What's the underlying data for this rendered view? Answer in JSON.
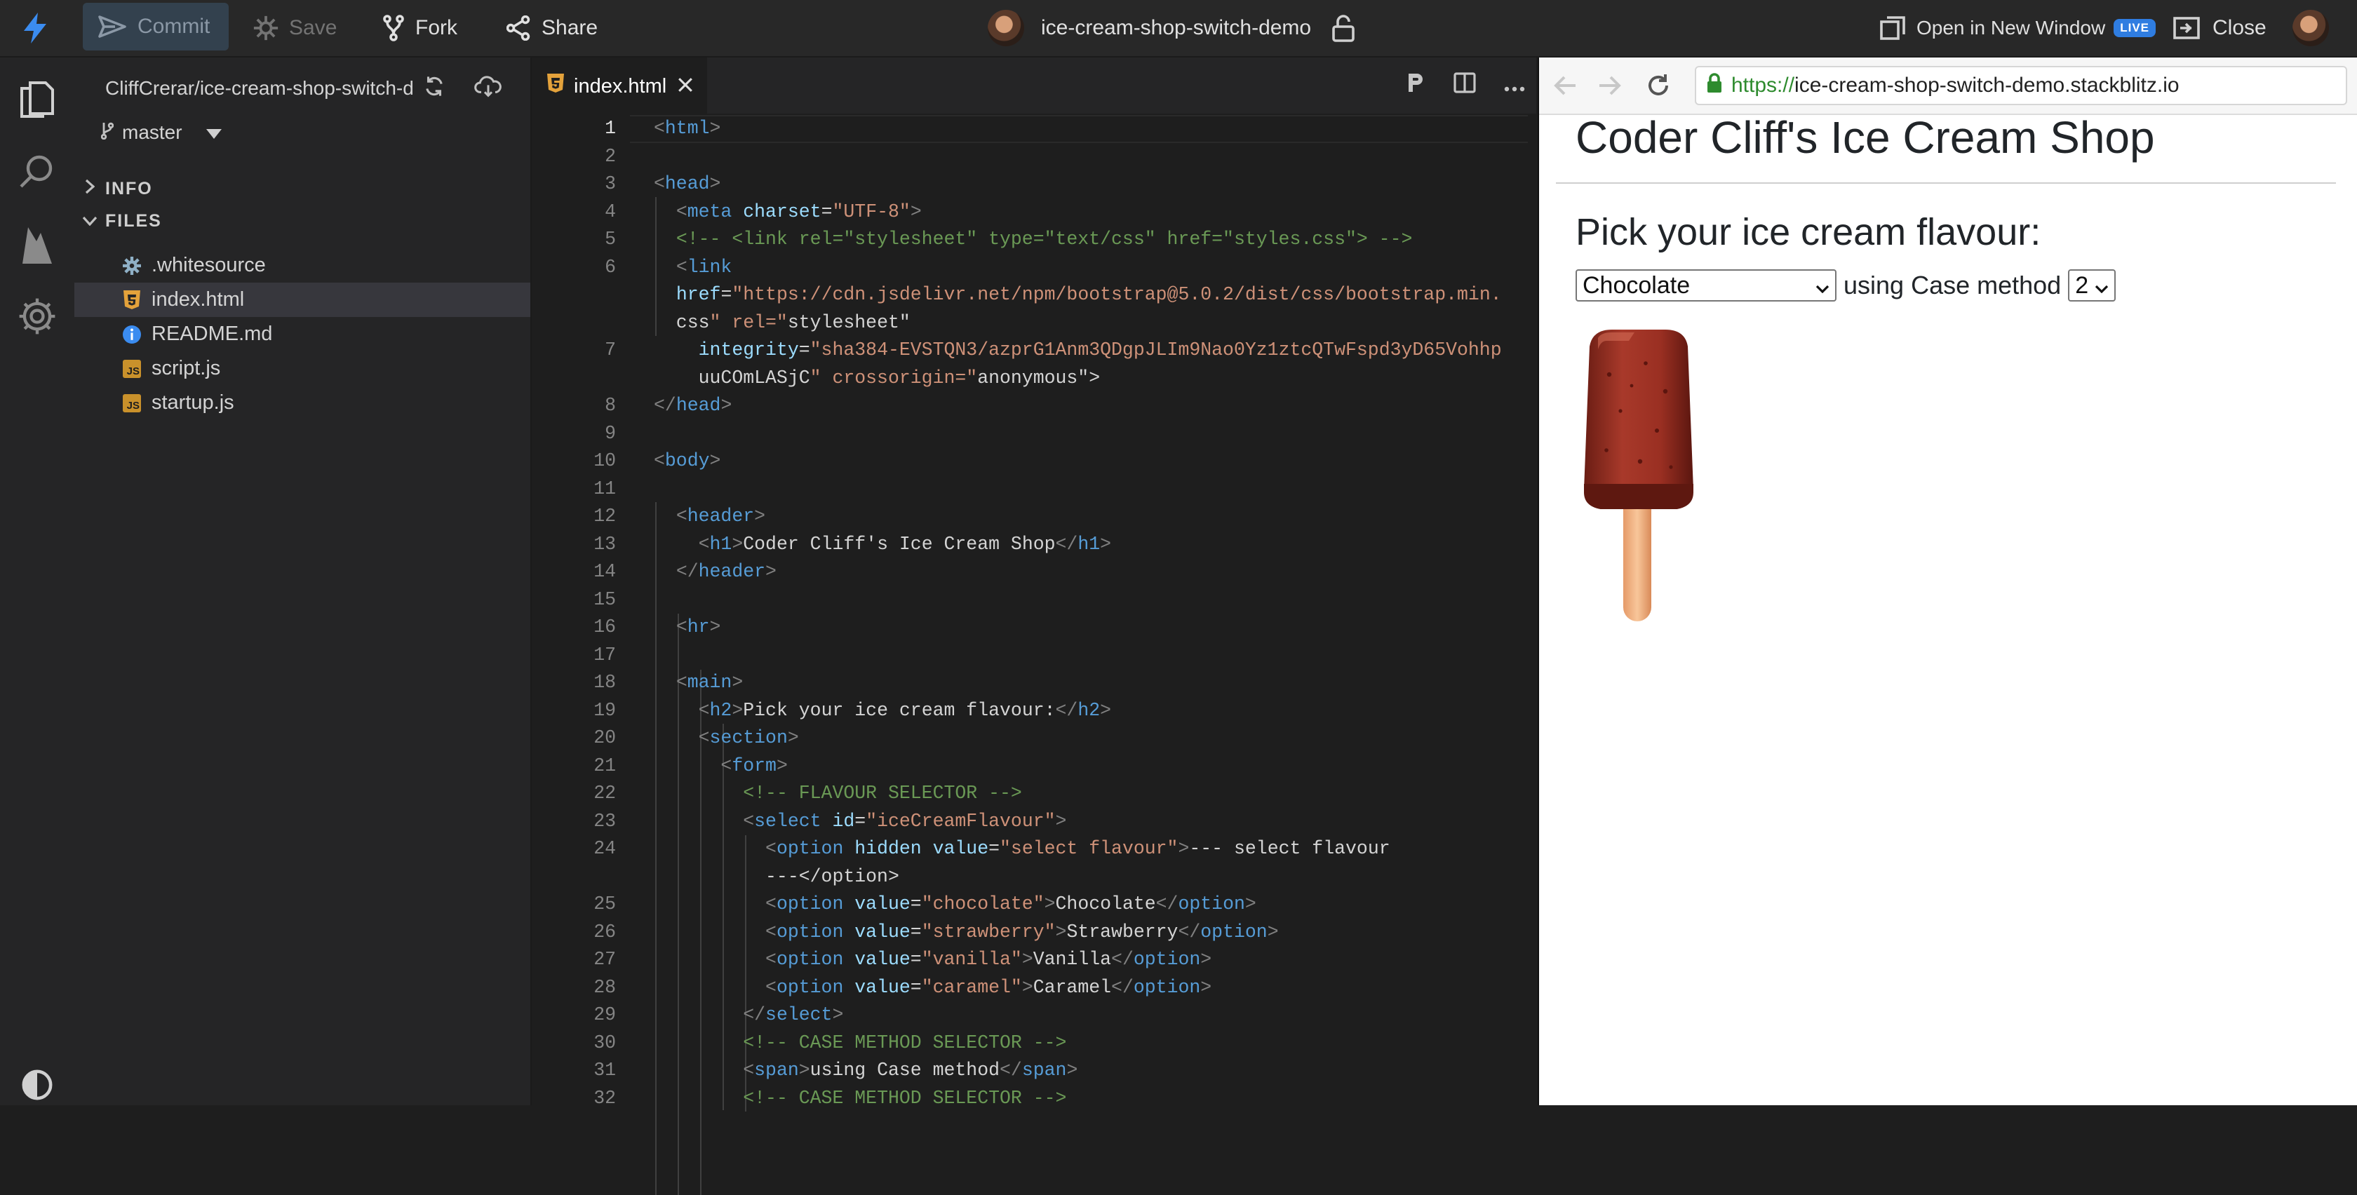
{
  "topbar": {
    "commit_label": "Commit",
    "save_label": "Save",
    "fork_label": "Fork",
    "share_label": "Share",
    "project_title": "ice-cream-shop-switch-demo",
    "open_window_label": "Open in New Window",
    "live_badge": "LIVE",
    "close_label": "Close"
  },
  "activity_icons": [
    "explorer-icon",
    "search-icon",
    "firebase-icon",
    "settings-icon",
    "theme-toggle-icon"
  ],
  "sidebar": {
    "repo": "CliffCrerar/ice-cream-shop-switch-demo",
    "branch": "master",
    "sections": {
      "info": "INFO",
      "files": "FILES"
    },
    "files": [
      {
        "name": ".whitesource",
        "icon": "gear-icon",
        "active": false
      },
      {
        "name": "index.html",
        "icon": "html5-icon",
        "active": true
      },
      {
        "name": "README.md",
        "icon": "info-icon",
        "active": false
      },
      {
        "name": "script.js",
        "icon": "js-icon",
        "active": false
      },
      {
        "name": "startup.js",
        "icon": "js-icon",
        "active": false
      }
    ]
  },
  "editor": {
    "tab_label": "index.html",
    "current_line": 1,
    "lines": [
      {
        "n": "1",
        "code": "<html>"
      },
      {
        "n": "2",
        "code": ""
      },
      {
        "n": "3",
        "code": "<head>"
      },
      {
        "n": "4",
        "code": "  <meta charset=\"UTF-8\">"
      },
      {
        "n": "5",
        "code": "  <!-- <link rel=\"stylesheet\" type=\"text/css\" href=\"styles.css\"> -->"
      },
      {
        "n": "6",
        "code": "  <link"
      },
      {
        "n": "",
        "code": "  href=\"https://cdn.jsdelivr.net/npm/bootstrap@5.0.2/dist/css/bootstrap.min."
      },
      {
        "n": "",
        "code": "  css\" rel=\"stylesheet\""
      },
      {
        "n": "7",
        "code": "    integrity=\"sha384-EVSTQN3/azprG1Anm3QDgpJLIm9Nao0Yz1ztcQTwFspd3yD65Vohhp"
      },
      {
        "n": "",
        "code": "    uuCOmLASjC\" crossorigin=\"anonymous\">"
      },
      {
        "n": "8",
        "code": "</head>"
      },
      {
        "n": "9",
        "code": ""
      },
      {
        "n": "10",
        "code": "<body>"
      },
      {
        "n": "11",
        "code": ""
      },
      {
        "n": "12",
        "code": "  <header>"
      },
      {
        "n": "13",
        "code": "    <h1>Coder Cliff's Ice Cream Shop</h1>"
      },
      {
        "n": "14",
        "code": "  </header>"
      },
      {
        "n": "15",
        "code": ""
      },
      {
        "n": "16",
        "code": "  <hr>"
      },
      {
        "n": "17",
        "code": ""
      },
      {
        "n": "18",
        "code": "  <main>"
      },
      {
        "n": "19",
        "code": "    <h2>Pick your ice cream flavour:</h2>"
      },
      {
        "n": "20",
        "code": "    <section>"
      },
      {
        "n": "21",
        "code": "      <form>"
      },
      {
        "n": "22",
        "code": "        <!-- FLAVOUR SELECTOR -->"
      },
      {
        "n": "23",
        "code": "        <select id=\"iceCreamFlavour\">"
      },
      {
        "n": "24",
        "code": "          <option hidden value=\"select flavour\">--- select flavour"
      },
      {
        "n": "",
        "code": "          ---</option>"
      },
      {
        "n": "25",
        "code": "          <option value=\"chocolate\">Chocolate</option>"
      },
      {
        "n": "26",
        "code": "          <option value=\"strawberry\">Strawberry</option>"
      },
      {
        "n": "27",
        "code": "          <option value=\"vanilla\">Vanilla</option>"
      },
      {
        "n": "28",
        "code": "          <option value=\"caramel\">Caramel</option>"
      },
      {
        "n": "29",
        "code": "        </select>"
      },
      {
        "n": "30",
        "code": "        <!-- CASE METHOD SELECTOR -->"
      },
      {
        "n": "31",
        "code": "        <span>using Case method</span>"
      },
      {
        "n": "32",
        "code": "        <!-- CASE METHOD SELECTOR -->"
      }
    ]
  },
  "preview": {
    "url_scheme": "https://",
    "url_host": "ice-cream-shop-switch-demo.stackblitz.io",
    "h1": "Coder Cliff's Ice Cream Shop",
    "h2": "Pick your ice cream flavour:",
    "flavour_selected": "Chocolate",
    "method_label": "using Case method",
    "method_selected": "2"
  }
}
